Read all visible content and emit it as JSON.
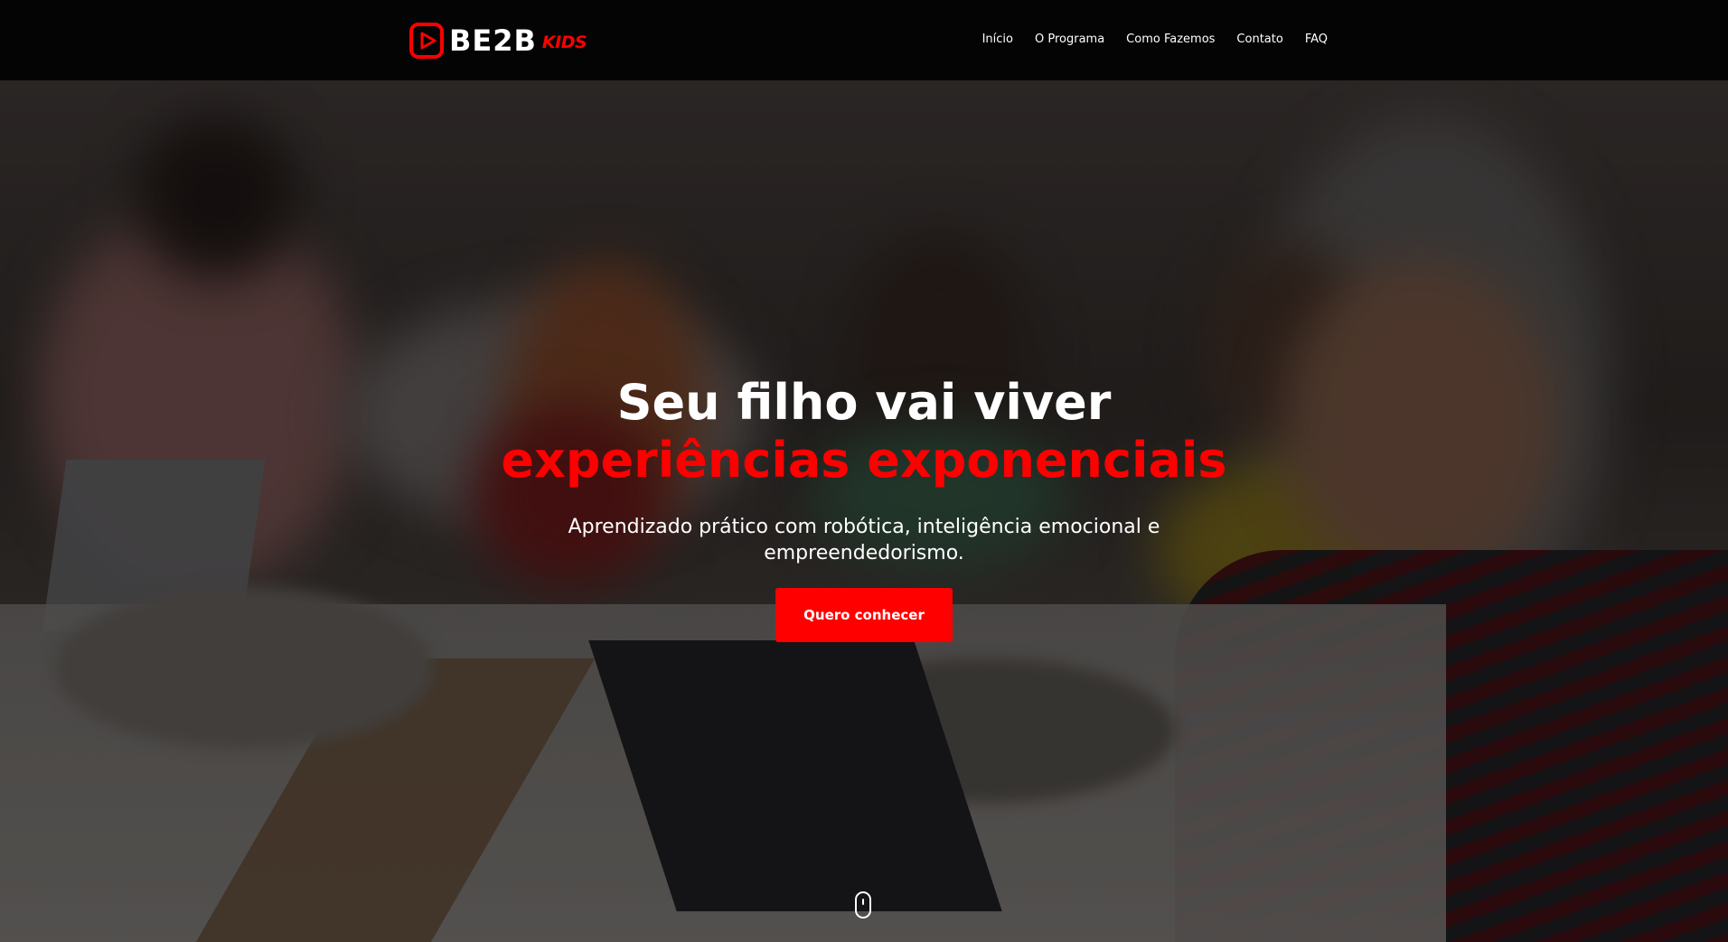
{
  "brand": {
    "name": "BE2B",
    "sub": "KIDS",
    "primary_color": "#ff0000"
  },
  "nav": {
    "items": [
      "Início",
      "O Programa",
      "Como Fazemos",
      "Contato",
      "FAQ"
    ]
  },
  "hero": {
    "headline_line1": "Seu filho vai viver",
    "headline_line2": "experiências exponenciais",
    "subtitle": "Aprendizado prático com robótica, inteligência emocional e empreendedorismo.",
    "cta_label": "Quero conhecer",
    "scroll_icon": "mouse-scroll-icon"
  }
}
